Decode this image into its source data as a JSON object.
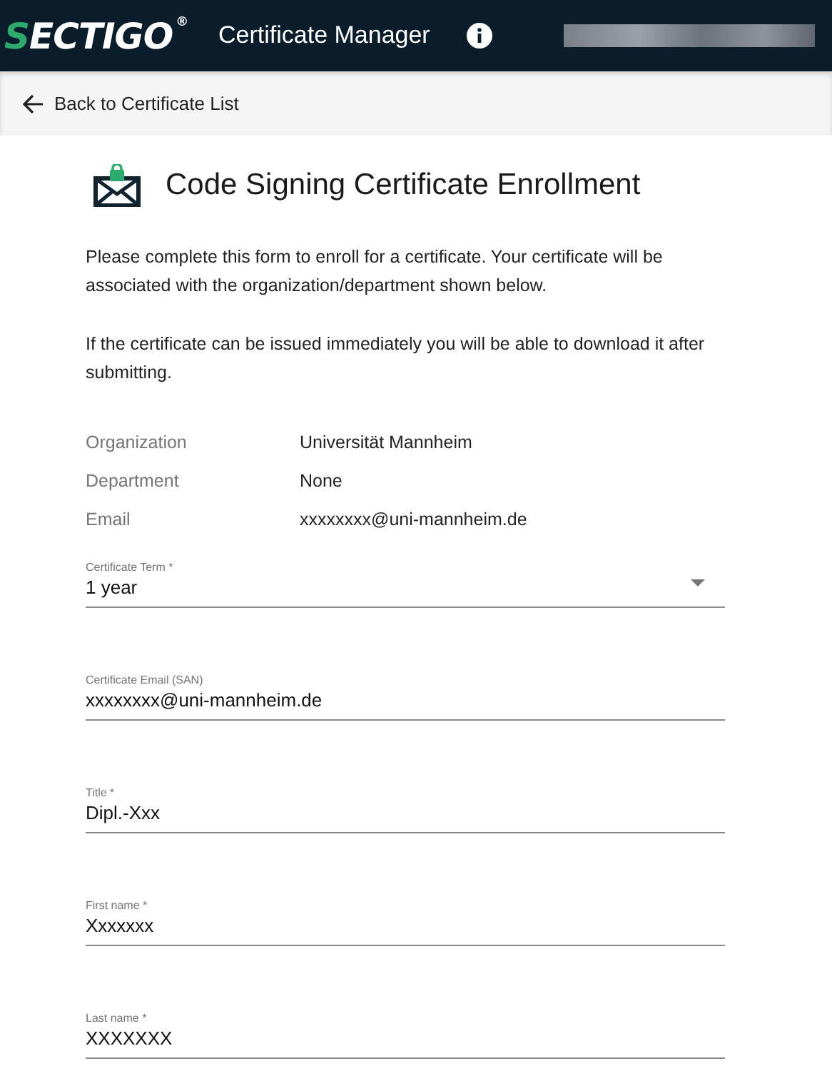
{
  "header": {
    "logo": {
      "mark": "S",
      "wordmark": "ECTIGO",
      "registered": "®"
    },
    "title": "Certificate Manager",
    "user_redacted": true
  },
  "back_link": {
    "label": "Back to Certificate List"
  },
  "page": {
    "title": "Code Signing Certificate Enrollment",
    "paragraphs": [
      "Please complete this form to enroll for a certificate. Your certificate will be associated with the organization/department shown below.",
      "If the certificate can be issued immediately you will be able to download it after submitting."
    ],
    "info": [
      {
        "label": "Organization",
        "value": "Universität Mannheim"
      },
      {
        "label": "Department",
        "value": "None"
      },
      {
        "label": "Email",
        "value": "xxxxxxxx@uni-mannheim.de"
      }
    ],
    "fields": [
      {
        "kind": "select",
        "label": "Certificate Term *",
        "value": "1 year"
      },
      {
        "kind": "text",
        "label": "Certificate Email (SAN)",
        "value": "xxxxxxxx@uni-mannheim.de"
      },
      {
        "kind": "text",
        "label": "Title *",
        "value": "Dipl.-Xxx"
      },
      {
        "kind": "text",
        "label": "First name *",
        "value": "Xxxxxxx"
      },
      {
        "kind": "text",
        "label": "Last name *",
        "value": "XXXXXXX"
      }
    ]
  }
}
